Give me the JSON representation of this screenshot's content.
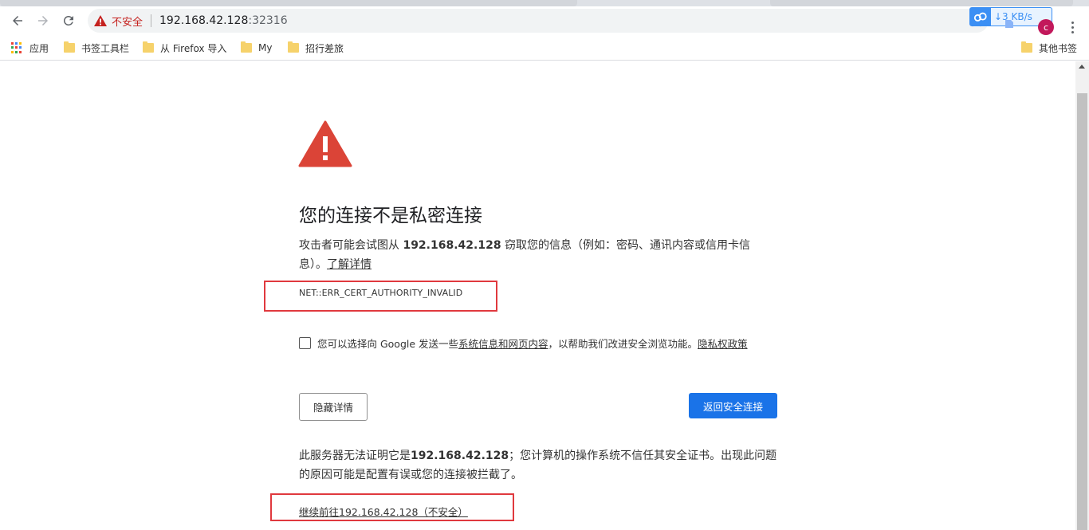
{
  "toolbar": {
    "security_label": "不安全",
    "url_host": "192.168.42.128",
    "url_port": ":32316"
  },
  "extension": {
    "speed_text": "↓3 KB/s"
  },
  "profile": {
    "avatar_letter": "c"
  },
  "bookmarks": {
    "apps_label": "应用",
    "items": [
      "书签工具栏",
      "从 Firefox 导入",
      "My",
      "招行差旅"
    ],
    "other_label": "其他书签"
  },
  "interstitial": {
    "heading": "您的连接不是私密连接",
    "explain_prefix": "攻击者可能会试图从 ",
    "explain_host": "192.168.42.128",
    "explain_suffix": " 窃取您的信息（例如：密码、通讯内容或信用卡信息）。",
    "learn_more": "了解详情",
    "error_code": "NET::ERR_CERT_AUTHORITY_INVALID",
    "optin_prefix": "您可以选择向 Google 发送一些",
    "optin_link": "系统信息和网页内容",
    "optin_middle": "，以帮助我们改进安全浏览功能。",
    "privacy_link": "隐私权政策",
    "details_button": "隐藏详情",
    "back_button": "返回安全连接",
    "server_prefix": "此服务器无法证明它是",
    "server_host": "192.168.42.128",
    "server_suffix": "；您计算机的操作系统不信任其安全证书。出现此问题的原因可能是配置有误或您的连接被拦截了。",
    "proceed_link": "继续前往192.168.42.128（不安全）"
  },
  "colors": {
    "danger": "#db4437",
    "primary": "#1a73e8",
    "annotation": "#e0393e"
  }
}
